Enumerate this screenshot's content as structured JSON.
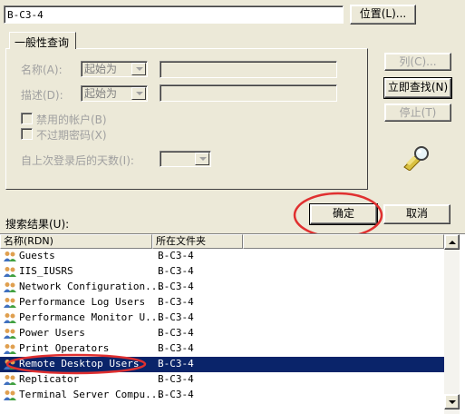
{
  "location": {
    "value": "B-C3-4",
    "button_label": "位置(L)..."
  },
  "tab": {
    "label": "一般性查询"
  },
  "query": {
    "name_label": "名称(A):",
    "name_mode": "起始为",
    "desc_label": "描述(D):",
    "desc_mode": "起始为",
    "disabled_accounts_label": "禁用的帐户(B)",
    "non_expiring_label": "不过期密码(X)",
    "days_label": "自上次登录后的天数(I):"
  },
  "side_buttons": {
    "columns": "列(C)...",
    "find_now": "立即查找(N)",
    "stop": "停止(T)"
  },
  "dialog_buttons": {
    "ok": "确定",
    "cancel": "取消"
  },
  "results": {
    "label": "搜索结果(U):",
    "columns": [
      "名称(RDN)",
      "所在文件夹"
    ],
    "rows": [
      {
        "name": "Guests",
        "folder": "B-C3-4"
      },
      {
        "name": "IIS_IUSRS",
        "folder": "B-C3-4"
      },
      {
        "name": "Network Configuration...",
        "folder": "B-C3-4"
      },
      {
        "name": "Performance Log Users",
        "folder": "B-C3-4"
      },
      {
        "name": "Performance Monitor U...",
        "folder": "B-C3-4"
      },
      {
        "name": "Power Users",
        "folder": "B-C3-4"
      },
      {
        "name": "Print Operators",
        "folder": "B-C3-4"
      },
      {
        "name": "Remote Desktop Users",
        "folder": "B-C3-4",
        "selected": true
      },
      {
        "name": "Replicator",
        "folder": "B-C3-4"
      },
      {
        "name": "Terminal Server Compu...",
        "folder": "B-C3-4"
      }
    ]
  },
  "colors": {
    "selection": "#0a246a",
    "annotation": "#e03030",
    "dialog_bg": "#ece9d8"
  }
}
